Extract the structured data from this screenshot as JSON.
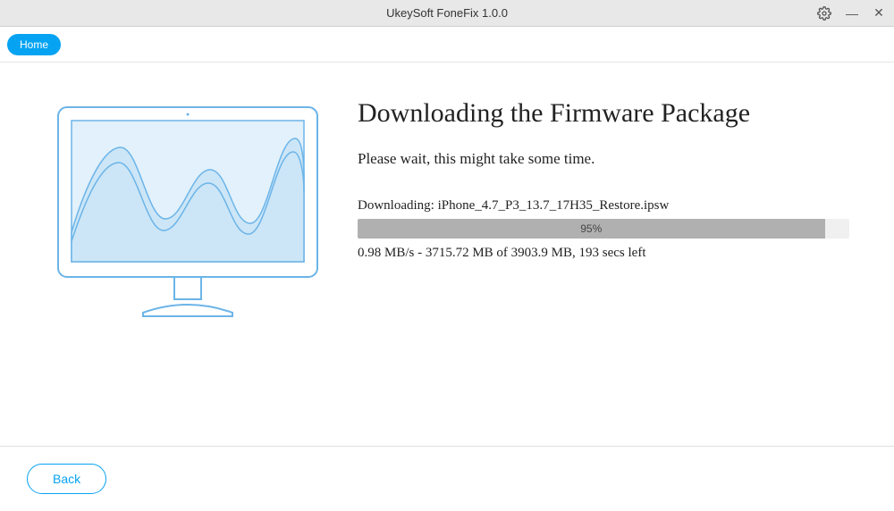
{
  "titlebar": {
    "title": "UkeySoft FoneFix 1.0.0"
  },
  "topbar": {
    "home_label": "Home"
  },
  "content": {
    "heading": "Downloading the Firmware Package",
    "subheading": "Please wait, this might take some time.",
    "download_label": "Downloading: iPhone_4.7_P3_13.7_17H35_Restore.ipsw",
    "progress_percent": "95%",
    "progress_width": "95%",
    "stats": "0.98 MB/s - 3715.72 MB of 3903.9 MB, 193 secs left"
  },
  "footer": {
    "back_label": "Back"
  }
}
